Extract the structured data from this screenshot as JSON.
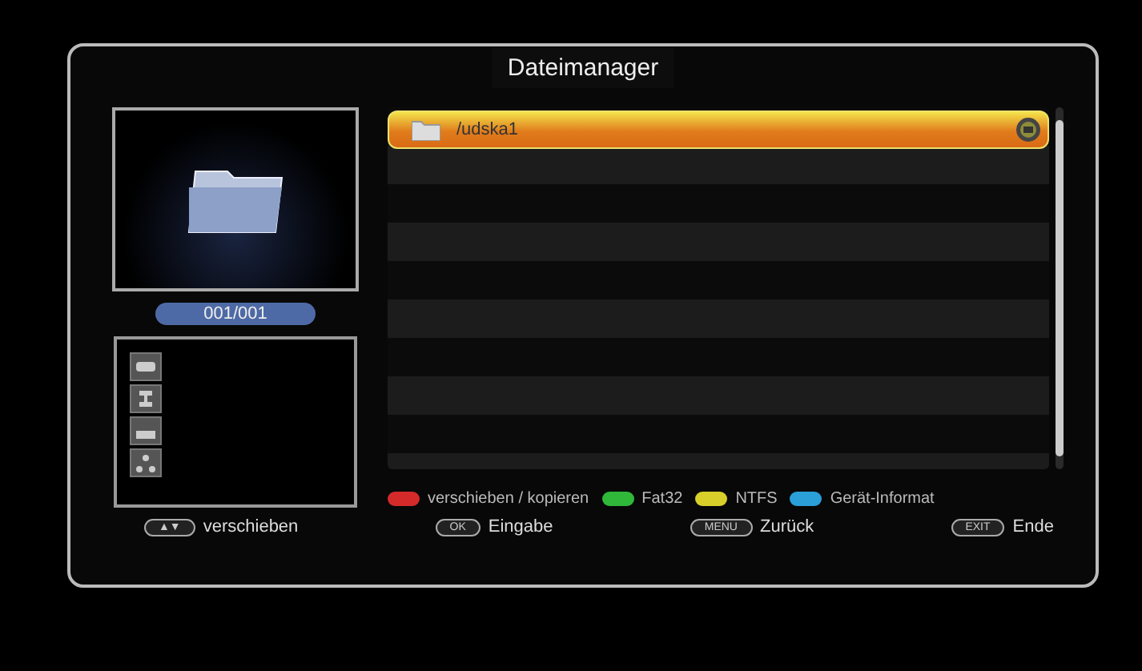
{
  "window": {
    "title": "Dateimanager"
  },
  "preview": {
    "counter": "001/001"
  },
  "files": [
    {
      "name": "/udska1",
      "selected": true
    }
  ],
  "color_keys": [
    {
      "color": "#d42a2a",
      "label": "verschieben / kopieren"
    },
    {
      "color": "#2fb83a",
      "label": "Fat32"
    },
    {
      "color": "#d8cf2a",
      "label": "NTFS"
    },
    {
      "color": "#2a9fd8",
      "label": "Gerät-Informat"
    }
  ],
  "hints": [
    {
      "key": "▲▼",
      "label": "verschieben"
    },
    {
      "key": "OK",
      "label": "Eingabe"
    },
    {
      "key": "MENU",
      "label": "Zurück"
    },
    {
      "key": "EXIT",
      "label": "Ende"
    }
  ]
}
